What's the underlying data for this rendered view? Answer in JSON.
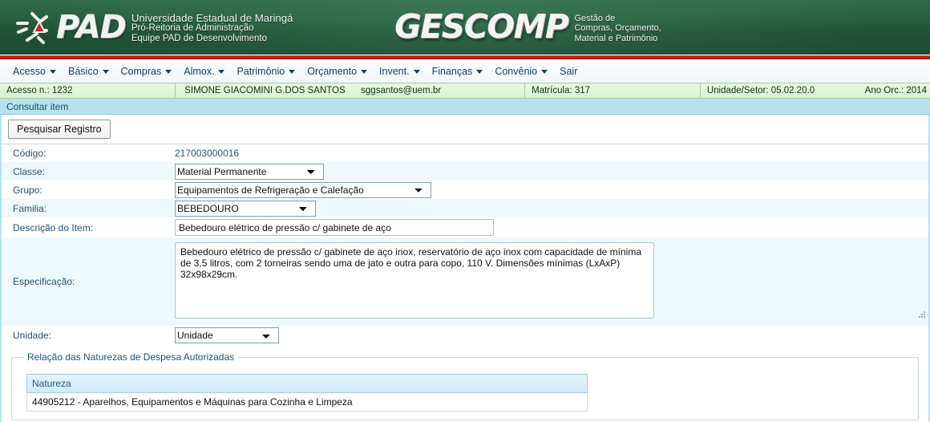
{
  "header": {
    "brand_left": {
      "logo_text": "PAD",
      "line1": "Universidade Estadual de Maringá",
      "line2": "Pró-Reitoria de Administração",
      "line3": "Equipe PAD de Desenvolvimento"
    },
    "brand_center": {
      "logo_text": "GESCOMP",
      "line1": "Gestão de",
      "line2": "Compras, Orçamento,",
      "line3": "Material e Patrimônio"
    },
    "accent_color": "#cc1414",
    "background_color": "#255943"
  },
  "menu": {
    "items": [
      {
        "label": "Acesso",
        "has_caret": true
      },
      {
        "label": "Básico",
        "has_caret": true
      },
      {
        "label": "Compras",
        "has_caret": true
      },
      {
        "label": "Almox.",
        "has_caret": true
      },
      {
        "label": "Patrimônio",
        "has_caret": true
      },
      {
        "label": "Orçamento",
        "has_caret": true
      },
      {
        "label": "Invent.",
        "has_caret": true
      },
      {
        "label": "Finanças",
        "has_caret": true
      },
      {
        "label": "Convênio",
        "has_caret": true
      },
      {
        "label": "Sair",
        "has_caret": false
      }
    ]
  },
  "infobar": {
    "acesso": "Acesso n.: 1232",
    "user_name": "SIMONE GIACOMINI G.DOS SANTOS",
    "email": "sggsantos@uem.br",
    "matricula": "Matrícula: 317",
    "unidade_setor": "Unidade/Setor: 05.02.20.0",
    "ano_orc": "Ano Orc.: 2014",
    "background_color": "#ddf4d6"
  },
  "page": {
    "title": "Consultar item",
    "title_background": "#b5e2ee"
  },
  "toolbar": {
    "search_button_label": "Pesquisar Registro"
  },
  "form": {
    "codigo": {
      "label": "Código:",
      "value": "217003000016"
    },
    "classe": {
      "label": "Classe:",
      "value": "Material Permanente"
    },
    "grupo": {
      "label": "Grupo:",
      "value": "Equipamentos de Refrigeração e Calefação"
    },
    "familia": {
      "label": "Familia:",
      "value": "BEBEDOURO"
    },
    "descricao": {
      "label": "Descrição do Item:",
      "value": "Bebedouro elétrico de pressão c/ gabinete de aço"
    },
    "especificacao": {
      "label": "Especificação:",
      "value": "Bebedouro elétrico de pressão c/ gabinete de aço inox, reservatório de aço inox com capacidade de mínima de 3,5 litros, com 2 torneiras sendo uma de jato e outra para copo, 110 V. Dimensões mínimas (LxAxP) 32x98x29cm."
    },
    "unidade": {
      "label": "Unidade:",
      "value": "Unidade"
    }
  },
  "naturezas": {
    "legend": "Relação das Naturezas de Despesa Autorizadas",
    "column_header": "Natureza",
    "rows": [
      "44905212 - Aparelhos, Equipamentos e Máquinas para Cozinha e Limpeza"
    ]
  }
}
